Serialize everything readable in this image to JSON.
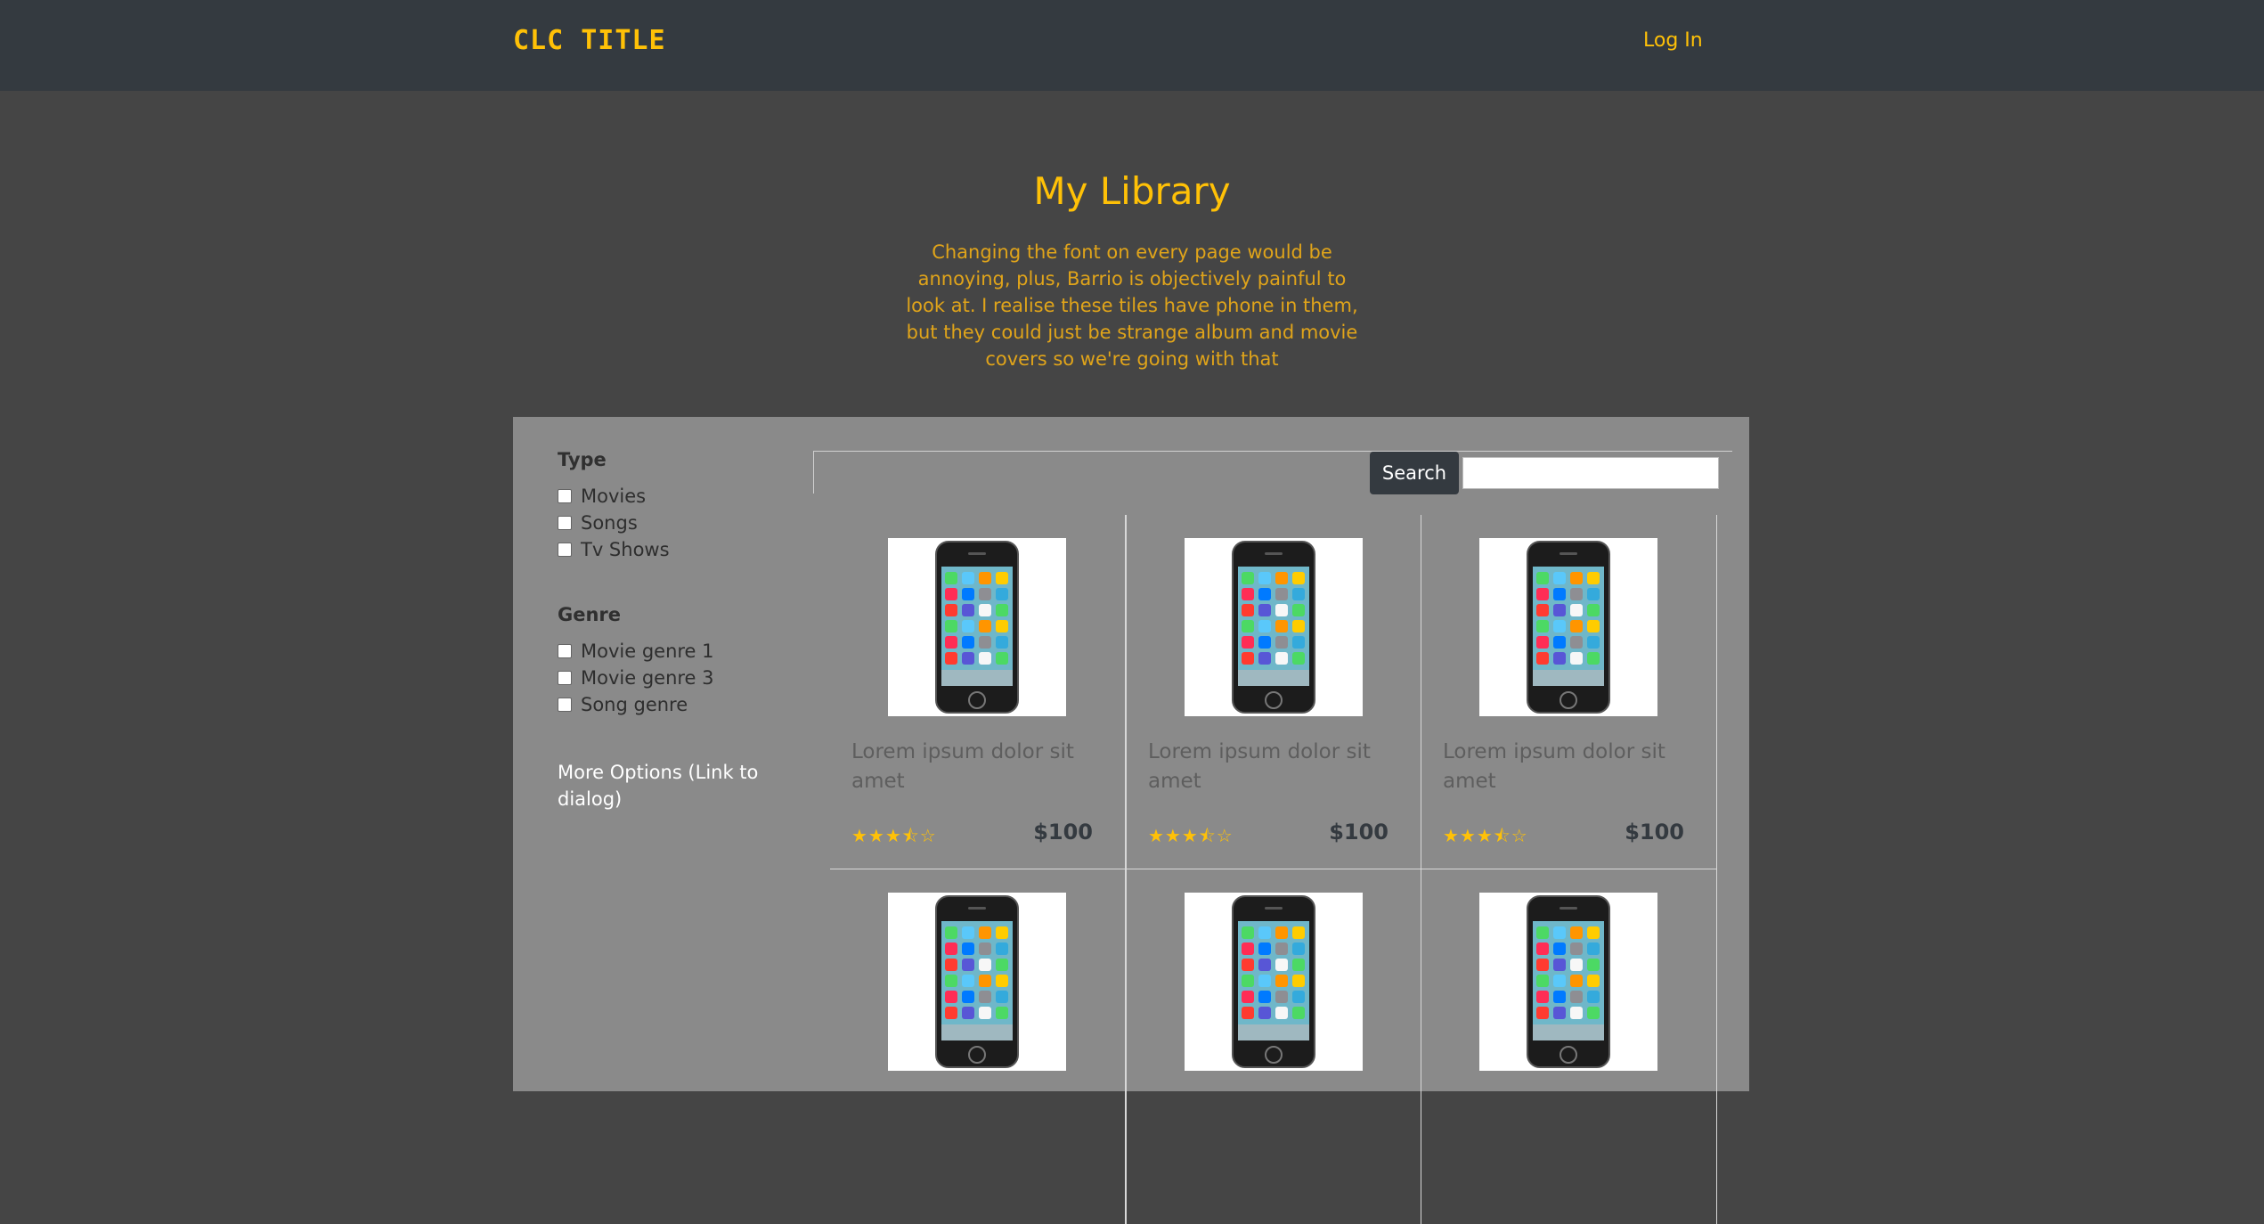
{
  "header": {
    "brand": "CLC TITLE",
    "login_label": "Log In"
  },
  "hero": {
    "title": "My Library",
    "description": "Changing the font on every page would be annoying, plus, Barrio is objectively painful to look at. I realise these tiles have phone in them, but they could just be strange album and movie covers so we're going with that"
  },
  "filters": {
    "type": {
      "heading": "Type",
      "options": [
        "Movies",
        "Songs",
        "Tv Shows"
      ]
    },
    "genre": {
      "heading": "Genre",
      "options": [
        "Movie genre 1",
        "Movie genre 3",
        "Song genre"
      ]
    },
    "more_options": "More Options (Link to dialog)"
  },
  "search": {
    "button_label": "Search",
    "value": ""
  },
  "products": [
    {
      "title": "Lorem ipsum dolor sit amet",
      "price": "$100",
      "rating": 3.5,
      "image": "phone-icon"
    },
    {
      "title": "Lorem ipsum dolor sit amet",
      "price": "$100",
      "rating": 3.5,
      "image": "phone-icon"
    },
    {
      "title": "Lorem ipsum dolor sit amet",
      "price": "$100",
      "rating": 3.5,
      "image": "phone-icon"
    },
    {
      "title": "",
      "price": "",
      "rating": null,
      "image": "phone-icon"
    },
    {
      "title": "",
      "price": "",
      "rating": null,
      "image": "phone-icon"
    },
    {
      "title": "",
      "price": "",
      "rating": null,
      "image": "phone-icon"
    }
  ],
  "colors": {
    "accent": "#ffc107",
    "navbar": "#343a40",
    "page_bg": "#454545",
    "panel_bg": "#8a8a8a"
  }
}
